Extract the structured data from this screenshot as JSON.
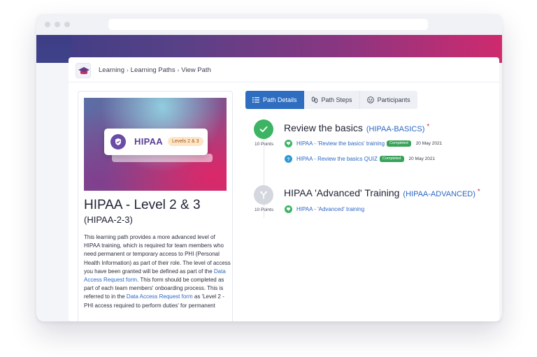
{
  "breadcrumb": {
    "items": [
      "Learning",
      "Learning Paths",
      "View Path"
    ]
  },
  "course": {
    "badge_title": "HIPAA",
    "badge_levels": "Levels 2 & 3",
    "title": "HIPAA - Level 2 & 3",
    "code": "(HIPAA-2-3)",
    "description": {
      "part1": "This learning path provides a more advanced level of HIPAA training, which is required for team members who need permanent or temporary access to PHI (Personal Health Information) as part of their role. The level of access you have been granted will be defined as part of the ",
      "link1": "Data Access Request form",
      "part2": ". This form should be completed as part of each team members' onboarding process. This is referred to in the ",
      "link2": "Data Access Request form",
      "part3": " as 'Level 2 - PHI access required to perform duties' for permanent"
    }
  },
  "tabs": [
    {
      "label": "Path Details",
      "active": true
    },
    {
      "label": "Path Steps",
      "active": false
    },
    {
      "label": "Participants",
      "active": false
    }
  ],
  "steps": [
    {
      "title": "Review the basics",
      "code": "(HIPAA-BASICS)",
      "required_mark": "*",
      "points": "10 Points",
      "status": "completed",
      "items": [
        {
          "label": "HIPAA - 'Review the basics' training",
          "status": "Completed",
          "date": "20 May 2021",
          "icon": "training-icon"
        },
        {
          "label": "HIPAA - Review the basics QUIZ",
          "status": "Completed",
          "date": "20 May 2021",
          "icon": "quiz-icon"
        }
      ]
    },
    {
      "title": "HIPAA 'Advanced' Training",
      "code": "(HIPAA-ADVANCED)",
      "required_mark": "*",
      "points": "10 Points",
      "status": "pending",
      "items": [
        {
          "label": "HIPAA - 'Advanced' training",
          "icon": "training-icon"
        }
      ]
    }
  ],
  "colors": {
    "primary": "#2e6dbf",
    "success": "#3db463",
    "link": "#2c67c4",
    "required": "#d0304f",
    "badge_purple": "#6a4ba6"
  }
}
